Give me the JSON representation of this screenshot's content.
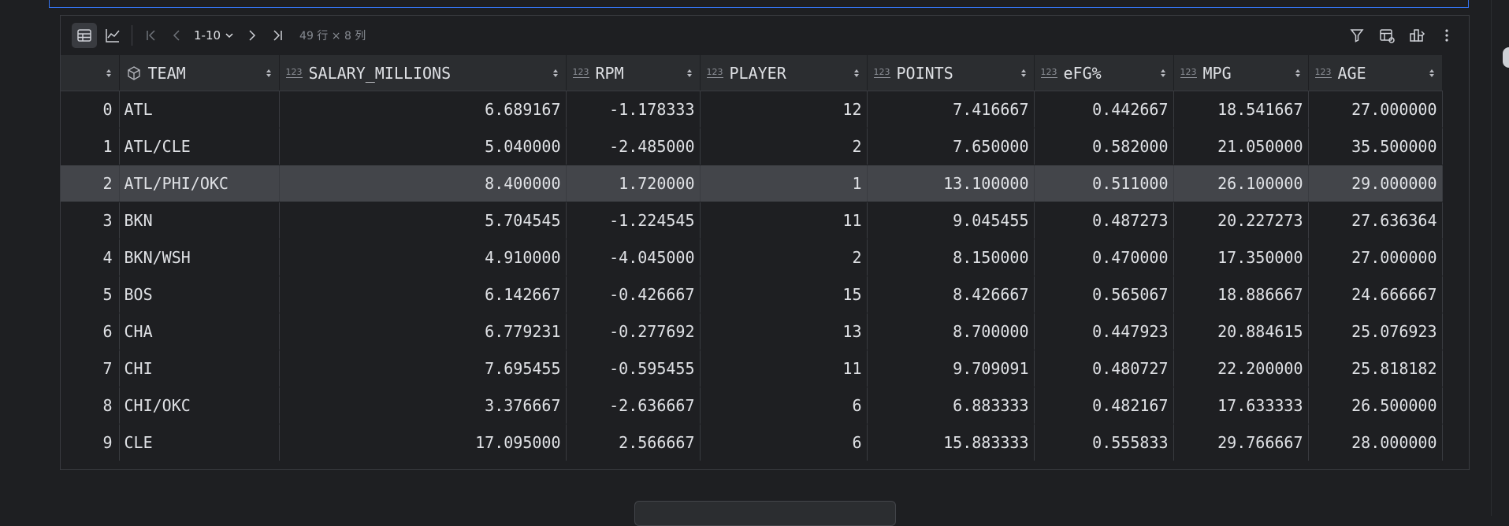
{
  "toolbar": {
    "page_range": "1-10",
    "dims": "49 行 × 8 列"
  },
  "columns": [
    {
      "name": "",
      "type": ""
    },
    {
      "name": "TEAM",
      "type": "text"
    },
    {
      "name": "SALARY_MILLIONS",
      "type": "123"
    },
    {
      "name": "RPM",
      "type": "123"
    },
    {
      "name": "PLAYER",
      "type": "123"
    },
    {
      "name": "POINTS",
      "type": "123"
    },
    {
      "name": "eFG%",
      "type": "123"
    },
    {
      "name": "MPG",
      "type": "123"
    },
    {
      "name": "AGE",
      "type": "123"
    }
  ],
  "rows": [
    [
      "0",
      "ATL",
      "6.689167",
      "-1.178333",
      "12",
      "7.416667",
      "0.442667",
      "18.541667",
      "27.000000"
    ],
    [
      "1",
      "ATL/CLE",
      "5.040000",
      "-2.485000",
      "2",
      "7.650000",
      "0.582000",
      "21.050000",
      "35.500000"
    ],
    [
      "2",
      "ATL/PHI/OKC",
      "8.400000",
      "1.720000",
      "1",
      "13.100000",
      "0.511000",
      "26.100000",
      "29.000000"
    ],
    [
      "3",
      "BKN",
      "5.704545",
      "-1.224545",
      "11",
      "9.045455",
      "0.487273",
      "20.227273",
      "27.636364"
    ],
    [
      "4",
      "BKN/WSH",
      "4.910000",
      "-4.045000",
      "2",
      "8.150000",
      "0.470000",
      "17.350000",
      "27.000000"
    ],
    [
      "5",
      "BOS",
      "6.142667",
      "-0.426667",
      "15",
      "8.426667",
      "0.565067",
      "18.886667",
      "24.666667"
    ],
    [
      "6",
      "CHA",
      "6.779231",
      "-0.277692",
      "13",
      "8.700000",
      "0.447923",
      "20.884615",
      "25.076923"
    ],
    [
      "7",
      "CHI",
      "7.695455",
      "-0.595455",
      "11",
      "9.709091",
      "0.480727",
      "22.200000",
      "25.818182"
    ],
    [
      "8",
      "CHI/OKC",
      "3.376667",
      "-2.636667",
      "6",
      "6.883333",
      "0.482167",
      "17.633333",
      "26.500000"
    ],
    [
      "9",
      "CLE",
      "17.095000",
      "2.566667",
      "6",
      "15.883333",
      "0.555833",
      "29.766667",
      "28.000000"
    ]
  ],
  "selected_row": 2
}
